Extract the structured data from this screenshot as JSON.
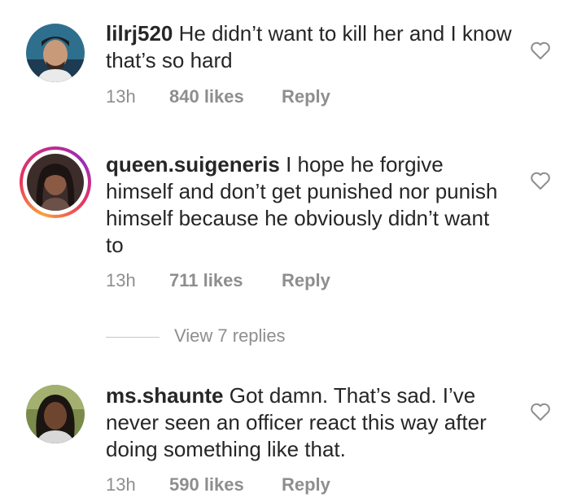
{
  "comments": [
    {
      "username": "lilrj520",
      "text": "He didn’t want to kill her and I know that’s so hard",
      "time": "13h",
      "likes": "840 likes",
      "reply": "Reply",
      "avatar_icon": "user-photo"
    },
    {
      "username": "queen.suigeneris",
      "text": "I hope he forgive himself and don’t get punished nor punish himself because he obviously didn’t want to",
      "time": "13h",
      "likes": "711 likes",
      "reply": "Reply",
      "avatar_icon": "user-photo-story-ring"
    },
    {
      "username": "ms.shaunte",
      "text": "Got damn. That’s sad. I’ve never seen an officer react this way after doing something like that.",
      "time": "13h",
      "likes": "590 likes",
      "reply": "Reply",
      "avatar_icon": "user-photo"
    }
  ],
  "view_replies": "View 7 replies",
  "colors": {
    "text": "#262626",
    "meta": "#8e8e8e",
    "story_ring_start": "#f9a23b",
    "story_ring_end": "#c42b8a"
  }
}
